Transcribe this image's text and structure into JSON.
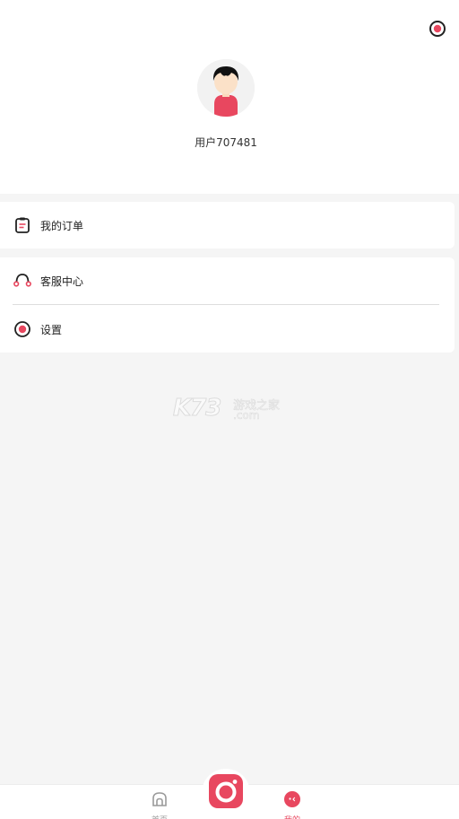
{
  "profile": {
    "username": "用户707481"
  },
  "menu": {
    "orders_label": "我的订单",
    "service_label": "客服中心",
    "settings_label": "设置"
  },
  "watermark": {
    "brand": "K73",
    "cn": "游戏之家",
    "domain": ".com"
  },
  "tabbar": {
    "home_label": "首页",
    "mine_label": "我的"
  },
  "colors": {
    "accent": "#e8475f",
    "background": "#f5f5f5"
  },
  "icons": {
    "top_right": "settings-icon",
    "orders": "clipboard-icon",
    "service": "headset-icon",
    "settings": "settings-icon",
    "home": "home-icon",
    "mine": "profile-icon",
    "center": "camera-icon"
  }
}
